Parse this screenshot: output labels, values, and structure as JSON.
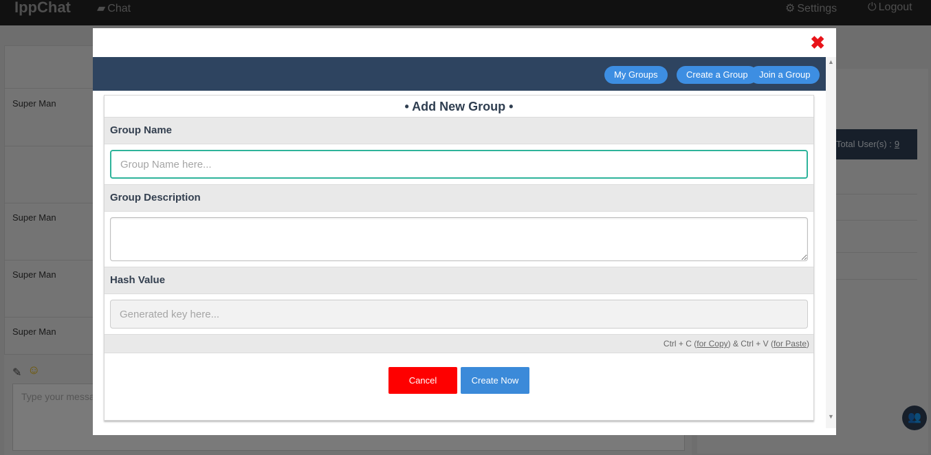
{
  "nav": {
    "brand": "IppChat",
    "chat_label": "Chat",
    "settings_label": "Settings",
    "logout_label": "Logout"
  },
  "chat": {
    "rows": [
      {
        "name": "Super Man"
      },
      {
        "name": "Super Man"
      },
      {
        "name": "Super Man"
      },
      {
        "name": "Super Man"
      }
    ],
    "message_placeholder": "Type your message..."
  },
  "users": {
    "total_label": "Total User(s) :",
    "total_count": "9"
  },
  "modal": {
    "close_symbol": "✖",
    "tabs": {
      "my_groups": "My Groups",
      "create_group": "Create a Group",
      "join_group": "Join a Group"
    },
    "form": {
      "title": "• Add New Group •",
      "group_name_label": "Group Name",
      "group_name_placeholder": "Group Name here...",
      "group_name_value": "",
      "description_label": "Group Description",
      "description_value": "",
      "hash_label": "Hash Value",
      "hash_placeholder": "Generated key here...",
      "hint": {
        "copy_prefix": "Ctrl + C (",
        "copy_link": "for Copy",
        "middle": ") & Ctrl + V (",
        "paste_link": "for Paste",
        "suffix": ")"
      },
      "cancel_label": "Cancel",
      "create_label": "Create Now"
    }
  },
  "colors": {
    "accent": "#3d8ee2",
    "header": "#2e4460",
    "danger": "#fe0000",
    "focus": "#2db39a"
  }
}
